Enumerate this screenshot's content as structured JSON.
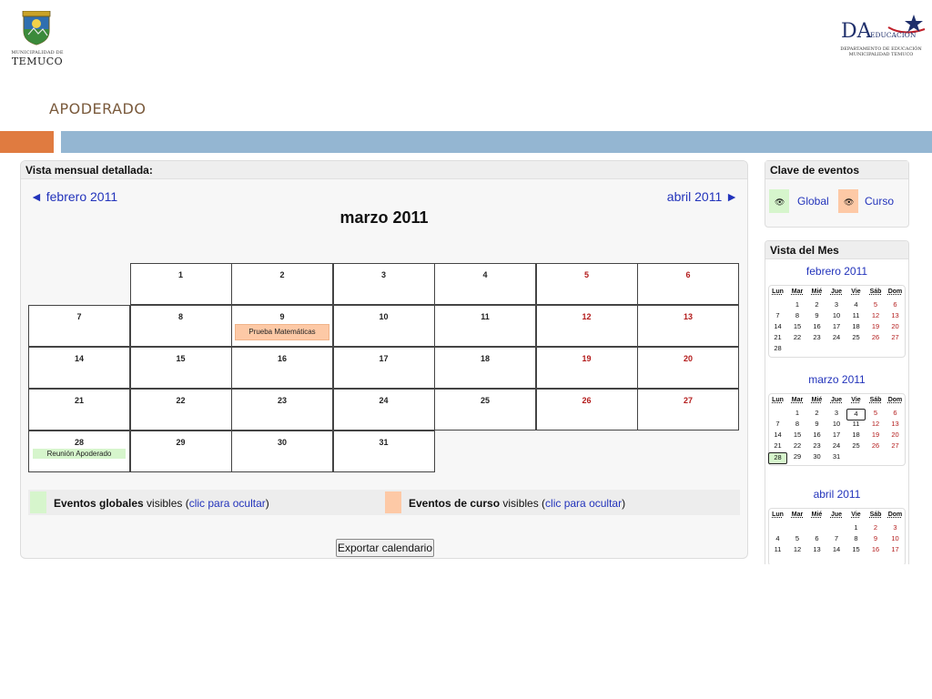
{
  "header": {
    "left_logo": {
      "line1": "MUNICIPALIDAD DE",
      "line2": "TEMUCO"
    },
    "right_logo": {
      "mark": "DA",
      "word": "EDUCACIÓN",
      "line1": "DEPARTAMENTO DE EDUCACIÓN",
      "line2": "MUNICIPALIDAD TEMUCO"
    },
    "title": "APODERADO"
  },
  "calendar": {
    "panel_title": "Vista mensual detallada:",
    "prev_link": "◄ febrero 2011",
    "next_link": "abril 2011 ►",
    "month_title": "marzo 2011",
    "weeks": [
      [
        null,
        {
          "d": "1"
        },
        {
          "d": "2"
        },
        {
          "d": "3"
        },
        {
          "d": "4"
        },
        {
          "d": "5",
          "we": true
        },
        {
          "d": "6",
          "we": true
        }
      ],
      [
        {
          "d": "7"
        },
        {
          "d": "8"
        },
        {
          "d": "9",
          "event": {
            "type": "course",
            "label": "Prueba Matemáticas"
          }
        },
        {
          "d": "10"
        },
        {
          "d": "11"
        },
        {
          "d": "12",
          "we": true
        },
        {
          "d": "13",
          "we": true
        }
      ],
      [
        {
          "d": "14"
        },
        {
          "d": "15"
        },
        {
          "d": "16"
        },
        {
          "d": "17"
        },
        {
          "d": "18"
        },
        {
          "d": "19",
          "we": true
        },
        {
          "d": "20",
          "we": true
        }
      ],
      [
        {
          "d": "21"
        },
        {
          "d": "22"
        },
        {
          "d": "23"
        },
        {
          "d": "24"
        },
        {
          "d": "25"
        },
        {
          "d": "26",
          "we": true
        },
        {
          "d": "27",
          "we": true
        }
      ],
      [
        {
          "d": "28",
          "event": {
            "type": "global",
            "label": "Reunión Apoderado"
          }
        },
        {
          "d": "29"
        },
        {
          "d": "30"
        },
        {
          "d": "31"
        },
        null,
        null,
        null
      ]
    ],
    "legend": {
      "global_bold": "Eventos globales",
      "global_mid": " visibles (",
      "global_link": "clic para ocultar",
      "global_end": ")",
      "course_bold": "Eventos de curso",
      "course_mid": " visibles (",
      "course_link": "clic para ocultar",
      "course_end": ")"
    },
    "export_button": "Exportar calendario"
  },
  "event_key": {
    "title": "Clave de eventos",
    "global_label": "Global",
    "course_label": "Curso",
    "icon": "eye-icon"
  },
  "month_view": {
    "title": "Vista del Mes",
    "weekday_headers": [
      "Lun",
      "Mar",
      "Mié",
      "Jue",
      "Vie",
      "Sáb",
      "Dom"
    ],
    "months": [
      {
        "name": "febrero 2011",
        "weeks": [
          [
            "",
            "1",
            "2",
            "3",
            "4",
            "5",
            "6"
          ],
          [
            "7",
            "8",
            "9",
            "10",
            "11",
            "12",
            "13"
          ],
          [
            "14",
            "15",
            "16",
            "17",
            "18",
            "19",
            "20"
          ],
          [
            "21",
            "22",
            "23",
            "24",
            "25",
            "26",
            "27"
          ],
          [
            "28",
            "",
            "",
            "",
            "",
            "",
            ""
          ]
        ]
      },
      {
        "name": "marzo 2011",
        "weeks": [
          [
            "",
            "1",
            "2",
            "3",
            "4",
            "5",
            "6"
          ],
          [
            "7",
            "8",
            "9",
            "10",
            "11",
            "12",
            "13"
          ],
          [
            "14",
            "15",
            "16",
            "17",
            "18",
            "19",
            "20"
          ],
          [
            "21",
            "22",
            "23",
            "24",
            "25",
            "26",
            "27"
          ],
          [
            "28",
            "29",
            "30",
            "31",
            "",
            "",
            ""
          ]
        ],
        "today": "4",
        "event_day": "28"
      },
      {
        "name": "abril 2011",
        "weeks": [
          [
            "",
            "",
            "",
            "",
            "1",
            "2",
            "3"
          ],
          [
            "4",
            "5",
            "6",
            "7",
            "8",
            "9",
            "10"
          ],
          [
            "11",
            "12",
            "13",
            "14",
            "15",
            "16",
            "17"
          ]
        ]
      }
    ]
  },
  "colors": {
    "orange_bar": "#e07b40",
    "blue_bar": "#94b6d2",
    "global_event": "#d6f5cc",
    "course_event": "#fdc9a6",
    "link": "#2233bb",
    "weekend": "#b31b1b"
  }
}
